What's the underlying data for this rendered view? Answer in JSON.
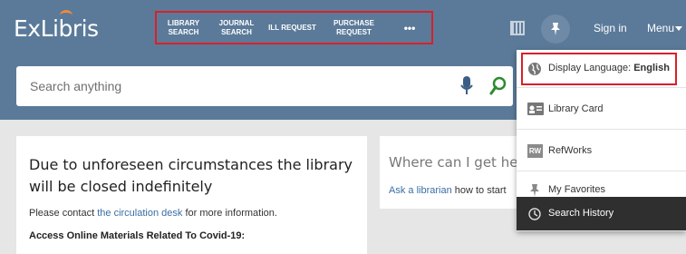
{
  "header": {
    "logo": "ExLibris",
    "nav": [
      {
        "label": "LIBRARY\nSEARCH"
      },
      {
        "label": "JOURNAL\nSEARCH"
      },
      {
        "label": "ILL REQUEST"
      },
      {
        "label": "PURCHASE\nREQUEST"
      },
      {
        "label": "•••"
      }
    ],
    "signin": "Sign in",
    "menu": "Menu"
  },
  "search": {
    "placeholder": "Search anything"
  },
  "announcement": {
    "title": "Due to unforeseen circumstances the library will be closed indefinitely",
    "contact_prefix": "Please contact ",
    "contact_link": "the circulation desk",
    "contact_suffix": " for more information.",
    "covid": "Access Online Materials Related To Covid-19:"
  },
  "help": {
    "title": "Where can I get help",
    "link": "Ask a librarian",
    "suffix": " how to start"
  },
  "dropdown": {
    "items": [
      {
        "label_prefix": "Display Language: ",
        "label_value": "English"
      },
      {
        "label": "Library Card"
      },
      {
        "label": "RefWorks"
      },
      {
        "label": "My Favorites"
      },
      {
        "label": "Search History"
      }
    ],
    "refworks_badge": "RW"
  },
  "colors": {
    "header_bg": "#5b7a99",
    "highlight_border": "#d9202a",
    "active_item_bg": "#2f2f2f",
    "link": "#3a6ea5"
  }
}
